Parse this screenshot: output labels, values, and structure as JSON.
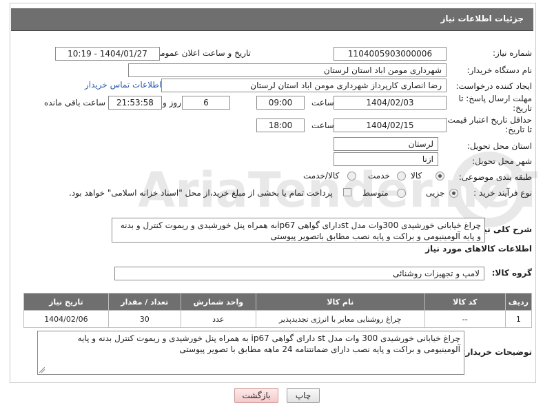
{
  "header": {
    "title": "جزئیات اطلاعات نیاز"
  },
  "fields": {
    "need_number_label": "شماره نیاز:",
    "need_number": "1104005903000006",
    "announce_label": "تاریخ و ساعت اعلان عمومی:",
    "announce_value": "1404/01/27 - 10:19",
    "buyer_org_label": "نام دستگاه خریدار:",
    "buyer_org": "شهرداری مومن اباد استان لرستان",
    "creator_label": "ایجاد کننده درخواست:",
    "creator": "رضا انصاری کارپرداز شهرداری مومن اباد استان لرستان",
    "contact_link": "اطلاعات تماس خریدار",
    "deadline_label_1": "مهلت ارسال پاسخ: تا",
    "deadline_label_2": "تاریخ:",
    "deadline_date": "1404/02/03",
    "time_word": "ساعت",
    "deadline_time": "09:00",
    "days_value": "6",
    "days_word": "روز و",
    "remaining_time": "21:53:58",
    "remaining_word": "ساعت باقی مانده",
    "validity_label_1": "حداقل تاریخ اعتبار قیمت:",
    "validity_label_2": "تا تاریخ:",
    "validity_date": "1404/02/15",
    "validity_time": "18:00",
    "province_label": "استان محل تحویل:",
    "province": "لرستان",
    "city_label": "شهر محل تحویل:",
    "city": "ازنا",
    "category_label": "طبقه بندی موضوعی:",
    "category_options": [
      "کالا",
      "خدمت",
      "کالا/خدمت"
    ],
    "category_selected": "کالا",
    "process_label": "نوع فرآیند خرید :",
    "process_options": [
      "جزیی",
      "متوسط"
    ],
    "process_selected": "جزیی",
    "payment_note": "پرداخت تمام یا بخشی از مبلغ خرید،از محل \"اسناد خزانه اسلامی\" خواهد بود."
  },
  "description": {
    "label": "شرح کلی نیاز:",
    "text": "چراغ خیابانی خورشیدی 300وات مدل stدارای گواهی ip67به همراه پنل خورشیدی و ریموت کنترل و بدنه و پایه آلومینیومی و براکت و پایه نصب مطابق باتصویر پیوستی"
  },
  "goods_info": {
    "title": "اطلاعات کالاهای مورد نیاز",
    "group_label": "گروه کالا:",
    "group_value": "لامپ و تجهیزات روشنائی"
  },
  "table": {
    "headers": [
      "ردیف",
      "کد کالا",
      "نام کالا",
      "واحد شمارش",
      "تعداد / مقدار",
      "تاریخ نیاز"
    ],
    "rows": [
      [
        "1",
        "--",
        "چراغ روشنایی معابر با انرژی تجدیدپذیر",
        "عدد",
        "30",
        "1404/02/06"
      ]
    ]
  },
  "buyer_notes": {
    "label": "توضیحات خریدار:",
    "text": "چراغ خیابانی خورشیدی 300 وات مدل st دارای گواهی ip67 به همراه پنل خورشیدی و ریموت کنترل بدنه و پایه آلومینیومی و براکت و پایه نصب دارای ضمانتنامه 24 ماهه مطابق با تصویر پیوستی"
  },
  "buttons": {
    "print": "چاپ",
    "back": "بازگشت"
  },
  "watermark": {
    "text": "AriaTender.neT"
  },
  "colors": {
    "header_bg": "#6f6f6f",
    "link": "#2a5db0",
    "back_button": "#f4c9c9"
  }
}
